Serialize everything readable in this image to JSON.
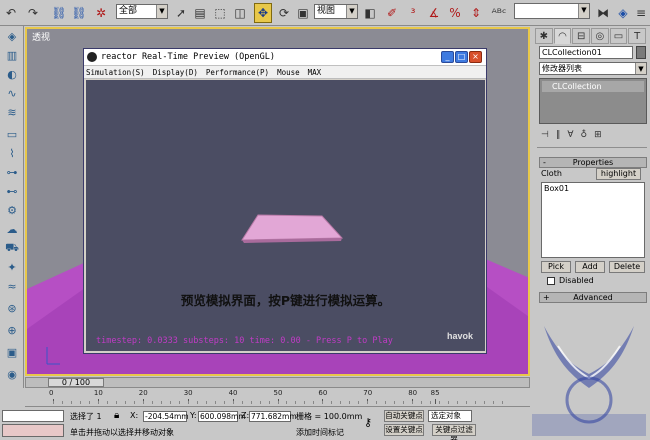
{
  "toolbar": {
    "selection_filter": "全部",
    "reference_coord": "视图",
    "icons": [
      "undo-icon",
      "redo-icon",
      "select-link-icon",
      "unlink-icon",
      "bind-spacewarp-icon",
      "select-object-icon",
      "select-by-name-icon",
      "rect-region-icon",
      "window-crossing-icon",
      "select-move-icon",
      "select-rotate-icon",
      "select-scale-icon",
      "pivot-icon",
      "select-manipulate-icon",
      "snap-icon",
      "angle-snap-icon",
      "percent-snap-icon",
      "spinner-snap-icon",
      "named-selection-icon",
      "mirror-icon",
      "align-icon",
      "layer-icon",
      "curve-editor-icon",
      "schematic-icon",
      "material-editor-icon",
      "render-scene-icon",
      "quick-render-icon"
    ]
  },
  "viewport": {
    "label": "透视",
    "highlight_color": "#e8c84a",
    "ground_color": "#b64fc4"
  },
  "reactor_window": {
    "title": "reactor Real-Time Preview (OpenGL)",
    "menu": [
      "Simulation(S)",
      "Display(D)",
      "Performance(P)",
      "Mouse",
      "MAX"
    ],
    "caption": "预览模拟界面，按P键进行模拟运算。",
    "status_line": "timestep: 0.0333  substeps: 10  time: 0.00 - Press P to Play",
    "logo_text": "havok",
    "min_button": "_",
    "max_button": "□",
    "close_button": "×"
  },
  "command_panel": {
    "tabs": [
      "create-tab-icon",
      "modify-tab-icon",
      "hierarchy-tab-icon",
      "motion-tab-icon",
      "display-tab-icon",
      "utilities-tab-icon"
    ],
    "object_name": "CLCollection01",
    "modifier_list": "修改器列表",
    "stack_item": "CLCollection",
    "properties_header": "Properties",
    "properties_sign": "-",
    "cloth_label": "Cloth",
    "highlight_label": "highlight",
    "objects": [
      "Box01"
    ],
    "pick_label": "Pick",
    "add_label": "Add",
    "delete_label": "Delete",
    "disabled_label": "Disabled",
    "advanced_header": "Advanced",
    "advanced_sign": "+"
  },
  "timeline": {
    "frame_display": "0 / 100",
    "ticks": [
      "0",
      "10",
      "20",
      "30",
      "40",
      "50",
      "60",
      "70",
      "80",
      "85"
    ]
  },
  "statusbar": {
    "selected": "选择了 1",
    "lock_icon": "lock-icon",
    "x_label": "X:",
    "x_value": "-204.54mm",
    "y_label": "Y:",
    "y_value": "600.098mm",
    "z_label": "Z:",
    "z_value": "771.682mm",
    "grid": "栅格 = 100.0mm",
    "auto_key": "自动关键点",
    "set_key": "设置关键点",
    "key_filter": "关键点过滤器",
    "selected_obj": "选定对象",
    "hint": "单击并拖动以选择并移动对象",
    "add_time_tag": "添加时间标记"
  }
}
